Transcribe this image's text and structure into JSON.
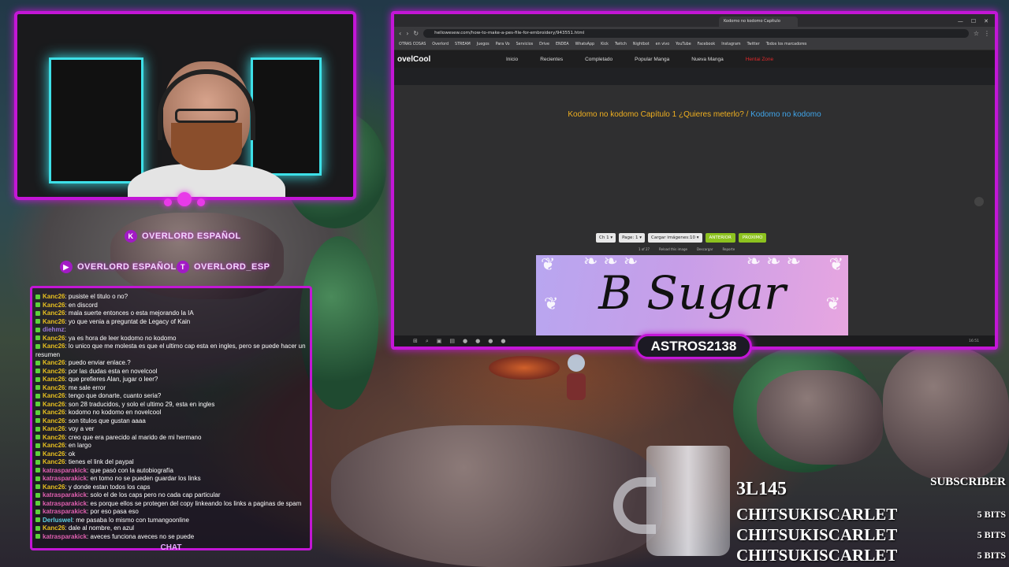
{
  "overlay": {
    "social_primary": "OVERLORD ESPAÑOL",
    "social_secondary_1": "OVERLORD ESPAÑOL",
    "social_secondary_2": "OVERLORD_ESP",
    "streamer_tag": "ASTROS2138",
    "chat_tab": "CHAT"
  },
  "chat": {
    "messages": [
      {
        "user": "Kanc26",
        "text": "pusiste el titulo o no?",
        "color": "#e8c020"
      },
      {
        "user": "Kanc26",
        "text": "en discord",
        "color": "#e8c020"
      },
      {
        "user": "Kanc26",
        "text": "mala suerte entonces o esta mejorando la IA",
        "color": "#e8c020"
      },
      {
        "user": "Kanc26",
        "text": "yo que venia a preguntat de Legacy of Kain",
        "color": "#e8c020"
      },
      {
        "user": "diehmz",
        "text": "",
        "color": "#9a7ad8"
      },
      {
        "user": "Kanc26",
        "text": "ya es hora de leer kodomo no kodomo",
        "color": "#e8c020"
      },
      {
        "user": "Kanc26",
        "text": "lo unico que me molesta es que el ultimo cap esta en ingles, pero se puede hacer un resumen",
        "color": "#e8c020"
      },
      {
        "user": "Kanc26",
        "text": "puedo enviar enlace.?",
        "color": "#e8c020"
      },
      {
        "user": "Kanc26",
        "text": "por las dudas esta en novelcool",
        "color": "#e8c020"
      },
      {
        "user": "Kanc26",
        "text": "que prefieres Alan, jugar o leer?",
        "color": "#e8c020"
      },
      {
        "user": "Kanc26",
        "text": "me sale error",
        "color": "#e8c020"
      },
      {
        "user": "Kanc26",
        "text": "tengo que donarte, cuanto seria?",
        "color": "#e8c020"
      },
      {
        "user": "Kanc26",
        "text": "son 28 traducidos, y solo el ultimo 29, esta en ingles",
        "color": "#e8c020"
      },
      {
        "user": "Kanc26",
        "text": "kodomo no kodomo en novelcool",
        "color": "#e8c020"
      },
      {
        "user": "Kanc26",
        "text": "son titulos que gustan aaaa",
        "color": "#e8c020"
      },
      {
        "user": "Kanc26",
        "text": "voy a ver",
        "color": "#e8c020"
      },
      {
        "user": "Kanc26",
        "text": "creo que era parecido al marido de mi hermano",
        "color": "#e8c020"
      },
      {
        "user": "Kanc26",
        "text": "en largo",
        "color": "#e8c020"
      },
      {
        "user": "Kanc26",
        "text": "ok",
        "color": "#e8c020"
      },
      {
        "user": "Kanc26",
        "text": "tienes el link del paypal",
        "color": "#e8c020"
      },
      {
        "user": "katrasparakick",
        "text": "que pasó con la autobiografía",
        "color": "#e060b0"
      },
      {
        "user": "katrasparakick",
        "text": "en tomo no se pueden guardar los links",
        "color": "#e060b0"
      },
      {
        "user": "Kanc26",
        "text": "y donde estan todos los caps",
        "color": "#e8c020"
      },
      {
        "user": "katrasparakick",
        "text": "solo el de los caps pero no cada cap particular",
        "color": "#e060b0"
      },
      {
        "user": "katrasparakick",
        "text": "es porque ellos se protegen del copy linkeando los links a paginas de spam",
        "color": "#e060b0"
      },
      {
        "user": "katrasparakick",
        "text": "por eso pasa eso",
        "color": "#e060b0"
      },
      {
        "user": "Derluswel",
        "text": "me pasaba lo mismo con tumangoonline",
        "color": "#60d0e0"
      },
      {
        "user": "Kanc26",
        "text": "dale al nombre, en azul",
        "color": "#e8c020"
      },
      {
        "user": "katrasparakick",
        "text": "aveces funciona aveces no se puede",
        "color": "#e060b0"
      }
    ]
  },
  "browser": {
    "tabs": [
      "",
      "",
      "",
      "",
      "Kodomo no kodomo Capítulo",
      ""
    ],
    "url": "hellowesew.com/how-to-make-a-pes-file-for-embroidery/943551.html",
    "bookmarks": [
      "OTRAS COSAS",
      "Overlord",
      "STREAM",
      "Juegos",
      "Para Vo",
      "Servicios",
      "Drive",
      "ENDEA",
      "WhatsApp",
      "Kick",
      "Twitch",
      "Nightbot",
      "en vivo",
      "YouTube",
      "Facebook",
      "Instagram",
      "Twitter",
      "Todos los marcadores"
    ],
    "site_logo": "ovelCool",
    "nav_links": [
      "Inicio",
      "Recientes",
      "Completado",
      "Popular Manga",
      "Nueva Manga",
      "Hentai Zone"
    ],
    "chapter_title": "Kodomo no kodomo Capítulo 1 ¿Quieres meterlo?",
    "chapter_sep": " / ",
    "series_link": "Kodomo no kodomo",
    "reader": {
      "chapter_select": "Ch 1",
      "page_select": "Page: 1",
      "load_select": "Cargar imágenes:10",
      "prev_button": "ANTERIOR",
      "next_button": "PROXIMO",
      "page_count": "1 of 27",
      "reload": "Reload this image",
      "download": "Descargar",
      "report": "Reporte"
    },
    "cover_text": "B Sugar",
    "clock": "16:51"
  },
  "alerts": {
    "subscriber_label": "SUBSCRIBER",
    "subscriber_name": "3L145",
    "bits": [
      {
        "name": "CHITSUKISCARLET",
        "amount": "5 BITS"
      },
      {
        "name": "CHITSUKISCARLET",
        "amount": "5 BITS"
      },
      {
        "name": "CHITSUKISCARLET",
        "amount": "5 BITS"
      }
    ]
  },
  "colors": {
    "accent": "#c316d6",
    "neon_cyan": "#3de0e8",
    "site_red": "#e0282a",
    "chapter_gold": "#f0b020",
    "link_blue": "#40a4e8",
    "button_green": "#8dc21f"
  }
}
